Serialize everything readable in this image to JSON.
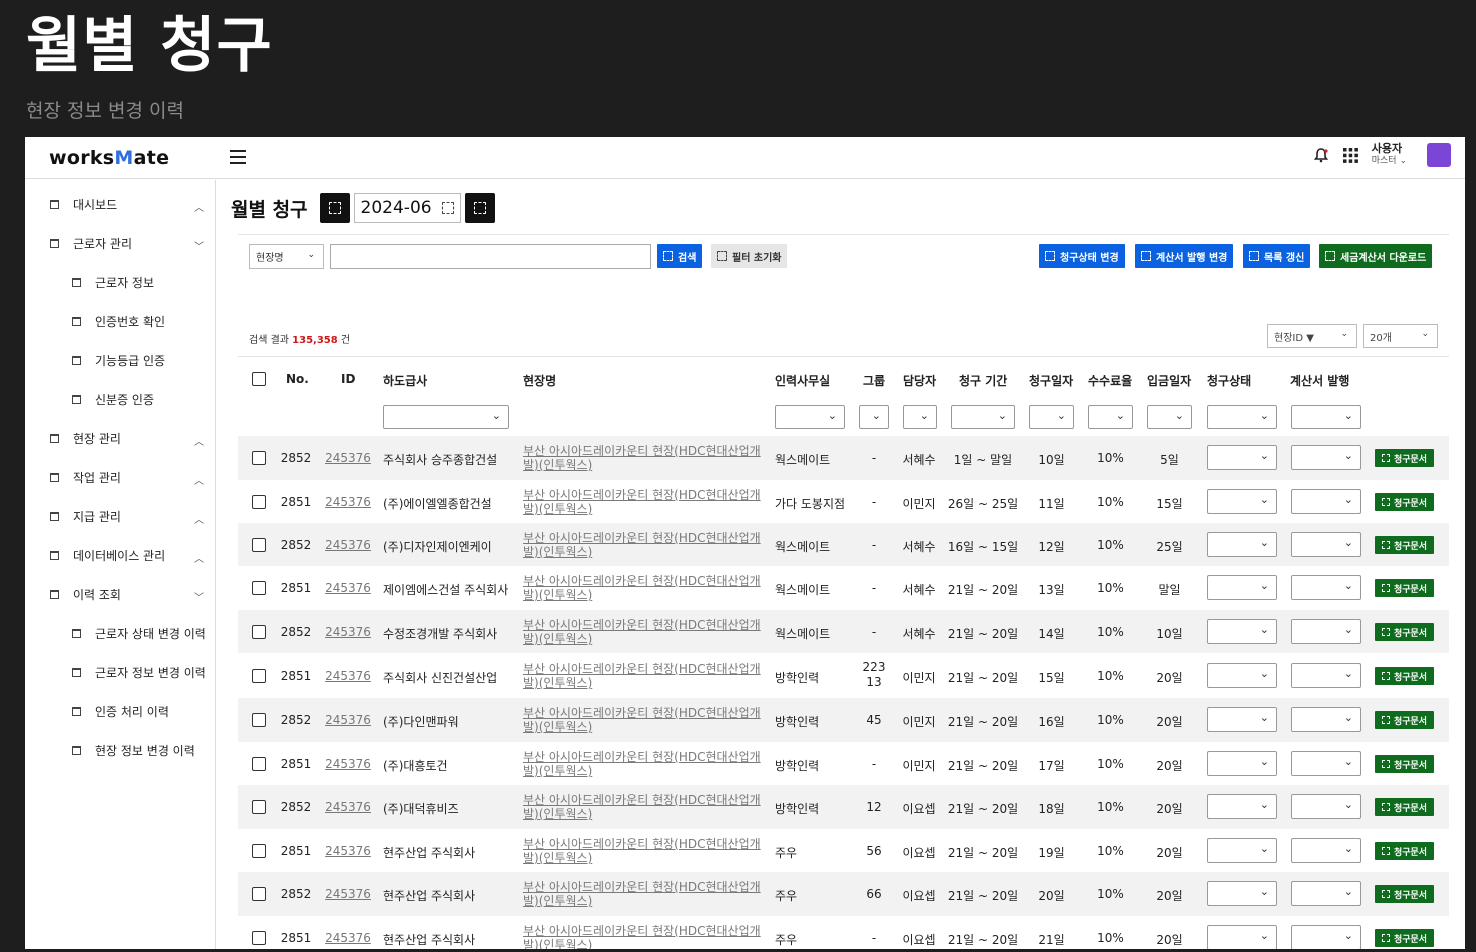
{
  "page": {
    "heading": "월별 청구",
    "subheading": "현장 정보 변경 이력"
  },
  "topbar": {
    "logo_prefix": "works",
    "logo_m": "M",
    "logo_suffix": "ate",
    "user_name": "사용자",
    "user_role": "마스터 ⌄"
  },
  "sidebar": {
    "items": [
      {
        "label": "대시보드",
        "chevron": "^"
      },
      {
        "label": "근로자 관리",
        "chevron": "v"
      },
      {
        "label": "근로자 정보",
        "chevron": ""
      },
      {
        "label": "인증번호 확인",
        "chevron": ""
      },
      {
        "label": "기능등급 인증",
        "chevron": ""
      },
      {
        "label": "신분증 인증",
        "chevron": ""
      },
      {
        "label": "현장 관리",
        "chevron": "^"
      },
      {
        "label": "작업 관리",
        "chevron": "^"
      },
      {
        "label": "지급 관리",
        "chevron": "^"
      },
      {
        "label": "데이터베이스 관리",
        "chevron": "^"
      },
      {
        "label": "이력 조회",
        "chevron": "v"
      },
      {
        "label": "근로자 상태 변경 이력",
        "chevron": ""
      },
      {
        "label": "근로자 정보 변경 이력",
        "chevron": ""
      },
      {
        "label": "인증 처리 이력",
        "chevron": ""
      },
      {
        "label": "현장 정보 변경 이력",
        "chevron": ""
      }
    ]
  },
  "main": {
    "title": "월별 청구",
    "month": "2024-06",
    "search_field": "현장명",
    "search_button": "검색",
    "reset_button": "필터 초기화",
    "action_buttons": [
      "청구상태 변경",
      "계산서 발행 변경",
      "목록 갱신",
      "세금계산서 다운로드"
    ],
    "result_prefix": "검색 결과 ",
    "result_count": "135,358",
    "result_suffix": " 건",
    "sort_by": "현장ID ▼",
    "page_size": "20개"
  },
  "table": {
    "headers": {
      "no": "No.",
      "id": "ID",
      "contractor": "하도급사",
      "site": "현장명",
      "office": "인력사무실",
      "group": "그룹",
      "manager": "담당자",
      "period": "청구 기간",
      "bill_day": "청구일자",
      "fee": "수수료율",
      "pay_day": "입금일자",
      "status": "청구상태",
      "invoice": "계산서 발행"
    },
    "doc_button": "청구문서",
    "rows": [
      {
        "no": "2852",
        "id": "245376",
        "contractor": "주식회사 승주종합건설",
        "site": "부산 아시아드레이카운티 현장(HDC현대산업개발)(인투웍스)",
        "office": "웍스메이트",
        "group": "-",
        "manager": "서혜수",
        "period": "1일 ~  말일",
        "bill_day": "10일",
        "fee": "10%",
        "pay_day": "5일"
      },
      {
        "no": "2851",
        "id": "245376",
        "contractor": "(주)에이엘엘종합건설",
        "site": "부산 아시아드레이카운티 현장(HDC현대산업개발)(인투웍스)",
        "office": "가다 도봉지점",
        "group": "-",
        "manager": "이민지",
        "period": "26일 ~ 25일",
        "bill_day": "11일",
        "fee": "10%",
        "pay_day": "15일"
      },
      {
        "no": "2852",
        "id": "245376",
        "contractor": "(주)디자인제이엔케이",
        "site": "부산 아시아드레이카운티 현장(HDC현대산업개발)(인투웍스)",
        "office": "웍스메이트",
        "group": "-",
        "manager": "서혜수",
        "period": "16일 ~ 15일",
        "bill_day": "12일",
        "fee": "10%",
        "pay_day": "25일"
      },
      {
        "no": "2851",
        "id": "245376",
        "contractor": "제이엠에스건설 주식회사",
        "site": "부산 아시아드레이카운티 현장(HDC현대산업개발)(인투웍스)",
        "office": "웍스메이트",
        "group": "-",
        "manager": "서혜수",
        "period": "21일 ~ 20일",
        "bill_day": "13일",
        "fee": "10%",
        "pay_day": "말일"
      },
      {
        "no": "2852",
        "id": "245376",
        "contractor": "수정조경개발 주식회사",
        "site": "부산 아시아드레이카운티 현장(HDC현대산업개발)(인투웍스)",
        "office": "웍스메이트",
        "group": "-",
        "manager": "서혜수",
        "period": "21일 ~ 20일",
        "bill_day": "14일",
        "fee": "10%",
        "pay_day": "10일"
      },
      {
        "no": "2851",
        "id": "245376",
        "contractor": "주식회사 신진건설산업",
        "site": "부산 아시아드레이카운티 현장(HDC현대산업개발)(인투웍스)",
        "office": "방학인력",
        "group": "223 13",
        "manager": "이민지",
        "period": "21일 ~ 20일",
        "bill_day": "15일",
        "fee": "10%",
        "pay_day": "20일"
      },
      {
        "no": "2852",
        "id": "245376",
        "contractor": "(주)다인맨파워",
        "site": "부산 아시아드레이카운티 현장(HDC현대산업개발)(인투웍스)",
        "office": "방학인력",
        "group": "45",
        "manager": "이민지",
        "period": "21일 ~ 20일",
        "bill_day": "16일",
        "fee": "10%",
        "pay_day": "20일"
      },
      {
        "no": "2851",
        "id": "245376",
        "contractor": "(주)대흥토건",
        "site": "부산 아시아드레이카운티 현장(HDC현대산업개발)(인투웍스)",
        "office": "방학인력",
        "group": "-",
        "manager": "이민지",
        "period": "21일 ~ 20일",
        "bill_day": "17일",
        "fee": "10%",
        "pay_day": "20일"
      },
      {
        "no": "2852",
        "id": "245376",
        "contractor": "(주)대덕휴비즈",
        "site": "부산 아시아드레이카운티 현장(HDC현대산업개발)(인투웍스)",
        "office": "방학인력",
        "group": "12",
        "manager": "이요셉",
        "period": "21일 ~ 20일",
        "bill_day": "18일",
        "fee": "10%",
        "pay_day": "20일"
      },
      {
        "no": "2851",
        "id": "245376",
        "contractor": "현주산업 주식회사",
        "site": "부산 아시아드레이카운티 현장(HDC현대산업개발)(인투웍스)",
        "office": "주우",
        "group": "56",
        "manager": "이요셉",
        "period": "21일 ~ 20일",
        "bill_day": "19일",
        "fee": "10%",
        "pay_day": "20일"
      },
      {
        "no": "2852",
        "id": "245376",
        "contractor": "현주산업 주식회사",
        "site": "부산 아시아드레이카운티 현장(HDC현대산업개발)(인투웍스)",
        "office": "주우",
        "group": "66",
        "manager": "이요셉",
        "period": "21일 ~ 20일",
        "bill_day": "20일",
        "fee": "10%",
        "pay_day": "20일"
      },
      {
        "no": "2851",
        "id": "245376",
        "contractor": "현주산업 주식회사",
        "site": "부산 아시아드레이카운티 현장(HDC현대산업개발)(인투웍스)",
        "office": "주우",
        "group": "-",
        "manager": "이요셉",
        "period": "21일 ~ 20일",
        "bill_day": "21일",
        "fee": "10%",
        "pay_day": "20일"
      }
    ]
  },
  "colors": {
    "primary_blue": "#0b62e0",
    "download_green": "#0f6b1e",
    "count_red": "#d01818",
    "avatar_purple": "#7b46d6"
  }
}
